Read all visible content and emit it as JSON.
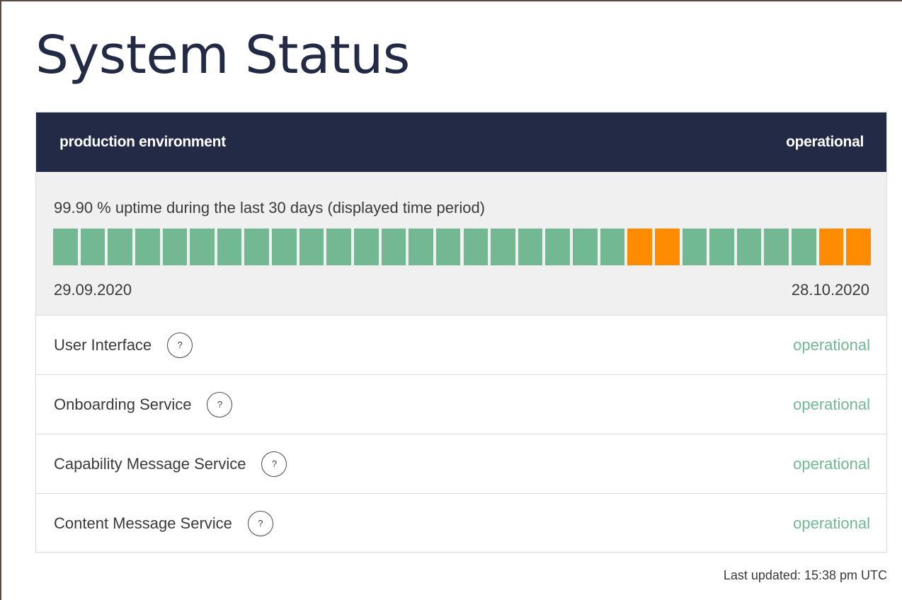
{
  "page": {
    "title": "System Status",
    "last_updated": "Last updated: 15:38 pm UTC"
  },
  "environment": {
    "name": "production environment",
    "status": "operational"
  },
  "uptime": {
    "summary": "99.90 % uptime during the last 30 days (displayed time period)",
    "start_date": "29.09.2020",
    "end_date": "28.10.2020",
    "days": [
      "up",
      "up",
      "up",
      "up",
      "up",
      "up",
      "up",
      "up",
      "up",
      "up",
      "up",
      "up",
      "up",
      "up",
      "up",
      "up",
      "up",
      "up",
      "up",
      "up",
      "up",
      "degraded",
      "degraded",
      "up",
      "up",
      "up",
      "up",
      "up",
      "degraded",
      "degraded"
    ]
  },
  "services": [
    {
      "name": "User Interface",
      "help": "?",
      "status": "operational"
    },
    {
      "name": "Onboarding Service",
      "help": "?",
      "status": "operational"
    },
    {
      "name": "Capability Message Service",
      "help": "?",
      "status": "operational"
    },
    {
      "name": "Content Message Service",
      "help": "?",
      "status": "operational"
    }
  ],
  "colors": {
    "header_bg": "#222a45",
    "up": "#72b892",
    "degraded": "#ff8c00",
    "panel_bg": "#f0f0f0"
  },
  "icons": {
    "help": "question-mark-circle-icon"
  }
}
